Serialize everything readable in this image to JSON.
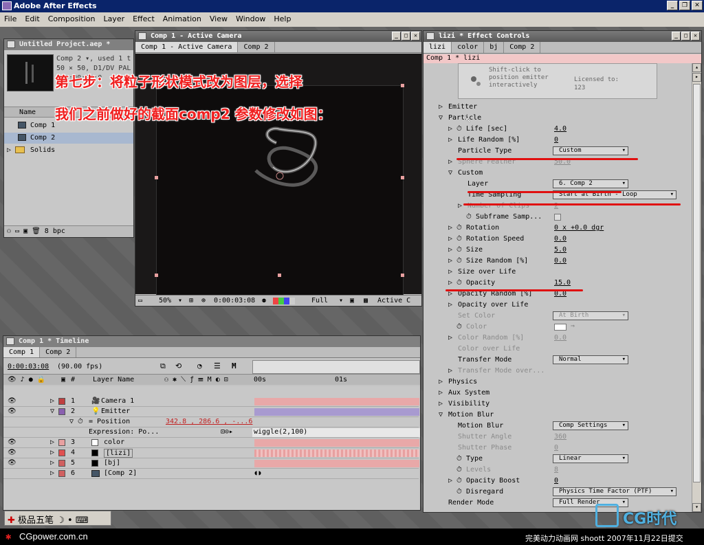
{
  "app": {
    "title": "Adobe After Effects"
  },
  "menu": [
    "File",
    "Edit",
    "Composition",
    "Layer",
    "Effect",
    "Animation",
    "View",
    "Window",
    "Help"
  ],
  "project": {
    "title": "Untitled Project.aep *",
    "info_line1": "Comp 2 ▾, used 1 t",
    "info_line2": "50 × 50, D1/DV PAL",
    "info_line3": "Δ 0:00:25:0",
    "col_name": "Name",
    "items": [
      "Comp 1",
      "Comp 2",
      "Solids"
    ],
    "bpc": "8 bpc"
  },
  "comp": {
    "title": "Comp 1 - Active Camera",
    "tab1": "Comp 1 - Active Camera",
    "tab2": "Comp 2",
    "zoom": "50%",
    "timecode": "0:00:03:08",
    "quality": "Full",
    "view": "Active C"
  },
  "effects": {
    "title": "lizi * Effect Controls",
    "tabs": [
      "lizi",
      "color",
      "bj",
      "Comp 2"
    ],
    "breadcrumb": "Comp 1 * lizi",
    "hint": "Shift-click to position emitter interactively",
    "licensed": "Licensed to:",
    "license_num": "123",
    "rows": [
      {
        "label": "Emitter",
        "indent": 0,
        "tri": "▷"
      },
      {
        "label": "Particle",
        "indent": 0,
        "tri": "▽"
      },
      {
        "label": "Life [sec]",
        "indent": 1,
        "tri": "▷",
        "stop": true,
        "value": "4.0"
      },
      {
        "label": "Life Random [%]",
        "indent": 1,
        "tri": "▷",
        "value": "0"
      },
      {
        "label": "Particle Type",
        "indent": 1,
        "tri": "",
        "dropdown": "Custom"
      },
      {
        "label": "Sphere Feather",
        "indent": 1,
        "tri": "▷",
        "dim": true,
        "value": "50.0"
      },
      {
        "label": "Custom",
        "indent": 1,
        "tri": "▽"
      },
      {
        "label": "Layer",
        "indent": 2,
        "tri": "",
        "dropdown": "6. Comp 2"
      },
      {
        "label": "Time Sampling",
        "indent": 2,
        "tri": "",
        "dropdown": "Start at Birth - Loop"
      },
      {
        "label": "Number of Clips",
        "indent": 2,
        "tri": "▷",
        "dim": true,
        "value": "2"
      },
      {
        "label": "Subframe Samp...",
        "indent": 2,
        "tri": "",
        "stop": true,
        "check": true
      },
      {
        "label": "Rotation",
        "indent": 1,
        "tri": "▷",
        "stop": true,
        "value": "0 x +0.0 dgr"
      },
      {
        "label": "Rotation Speed",
        "indent": 1,
        "tri": "▷",
        "stop": true,
        "value": "0.0"
      },
      {
        "label": "Size",
        "indent": 1,
        "tri": "▷",
        "stop": true,
        "value": "5.0"
      },
      {
        "label": "Size Random [%]",
        "indent": 1,
        "tri": "▷",
        "stop": true,
        "value": "0.0"
      },
      {
        "label": "Size over Life",
        "indent": 1,
        "tri": "▷"
      },
      {
        "label": "Opacity",
        "indent": 1,
        "tri": "▷",
        "stop": true,
        "value": "15.0"
      },
      {
        "label": "Opacity Random [%]",
        "indent": 1,
        "tri": "▷",
        "value": "0.0"
      },
      {
        "label": "Opacity over Life",
        "indent": 1,
        "tri": "▷"
      },
      {
        "label": "Set Color",
        "indent": 1,
        "tri": "",
        "dim": true,
        "dropdown": "At Birth",
        "ddim": true
      },
      {
        "label": "Color",
        "indent": 1,
        "tri": "",
        "stop": true,
        "dim": true,
        "color": true
      },
      {
        "label": "Color Random [%]",
        "indent": 1,
        "tri": "▷",
        "dim": true,
        "value": "0.0"
      },
      {
        "label": "Color over Life",
        "indent": 1,
        "tri": "",
        "dim": true
      },
      {
        "label": "Transfer Mode",
        "indent": 1,
        "tri": "",
        "dropdown": "Normal"
      },
      {
        "label": "Transfer Mode over...",
        "indent": 1,
        "tri": "▷",
        "dim": true
      },
      {
        "label": "Physics",
        "indent": 0,
        "tri": "▷"
      },
      {
        "label": "Aux System",
        "indent": 0,
        "tri": "▷"
      },
      {
        "label": "Visibility",
        "indent": 0,
        "tri": "▷"
      },
      {
        "label": "Motion Blur",
        "indent": 0,
        "tri": "▽"
      },
      {
        "label": "Motion Blur",
        "indent": 1,
        "tri": "",
        "dropdown": "Comp Settings"
      },
      {
        "label": "Shutter Angle",
        "indent": 1,
        "tri": "",
        "dim": true,
        "value": "360"
      },
      {
        "label": "Shutter Phase",
        "indent": 1,
        "tri": "",
        "dim": true,
        "value": "0"
      },
      {
        "label": "Type",
        "indent": 1,
        "tri": "",
        "stop": true,
        "dropdown": "Linear"
      },
      {
        "label": "Levels",
        "indent": 1,
        "tri": "",
        "stop": true,
        "dim": true,
        "value": "8"
      },
      {
        "label": "Opacity Boost",
        "indent": 1,
        "tri": "▷",
        "stop": true,
        "value": "0"
      },
      {
        "label": "Disregard",
        "indent": 1,
        "tri": "",
        "stop": true,
        "dropdown": "Physics Time Factor (PTF)"
      },
      {
        "label": "Render Mode",
        "indent": 0,
        "tri": "",
        "dropdown": "Full Render"
      }
    ]
  },
  "timeline": {
    "title": "Comp 1 * Timeline",
    "tab1": "Comp 1",
    "tab2": "Comp 2",
    "timecode": "0:00:03:08",
    "fps": "(90.00 fps)",
    "col_num": "#",
    "col_name": "Layer Name",
    "ruler": [
      "00s",
      "01s"
    ],
    "layers": [
      {
        "num": "1",
        "name": "Camera 1",
        "color": "#c04040"
      },
      {
        "num": "2",
        "name": "Emitter",
        "color": "#8a60b0"
      },
      {
        "num": "",
        "name": "Position",
        "value": "342.8 , 286.6 , -...6"
      },
      {
        "num": "",
        "name": "Expression: Po...",
        "expr": "wiggle(2,100)"
      },
      {
        "num": "3",
        "name": "color",
        "color": "#d8d8d8"
      },
      {
        "num": "4",
        "name": "[lizi]",
        "color": "#e05050"
      },
      {
        "num": "5",
        "name": "[bj]",
        "color": "#d06060"
      },
      {
        "num": "6",
        "name": "[Comp 2]",
        "color": "#d06060"
      }
    ]
  },
  "overlay": {
    "line1": "第七步：将粒子形状模式改为图层，选择",
    "line2": "我们之前做好的截面comp2  参数修改如图："
  },
  "taskbar": {
    "ime": "极品五笔",
    "site": "CGpower.com.cn",
    "credit": "完美动力动画网 shoott 2007年11月22日提交",
    "logo": "CG时代"
  }
}
